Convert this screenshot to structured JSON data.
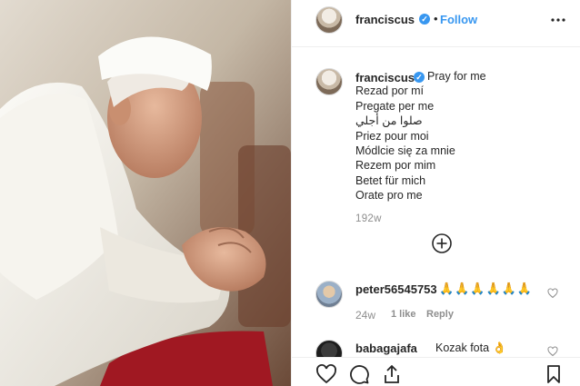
{
  "post": {
    "photo": "praying-man-photo"
  },
  "header": {
    "username": "franciscus",
    "verified_mark": "✓",
    "separator": "•",
    "follow_label": "Follow",
    "more_icon": "more-options-icon"
  },
  "caption": {
    "username": "franciscus",
    "verified_mark": "✓",
    "lines": [
      "Pray for me",
      "Rezad por mí",
      "Pregate per me",
      "صلوا من أجلي",
      "Priez pour moi",
      "Módlcie się za mnie",
      "Rezem por mim",
      "Betet für mich",
      "Orate pro me"
    ],
    "timestamp": "192w",
    "load_more_icon": "plus-circle-icon"
  },
  "comments": [
    {
      "username": "peter56545753",
      "text": "🙏🙏🙏🙏🙏🙏",
      "age": "24w",
      "likes": "1 like",
      "reply_label": "Reply"
    },
    {
      "username": "babagajafa",
      "text": "Kozak fota 👌"
    }
  ],
  "actions": {
    "like_icon": "heart-icon",
    "comment_icon": "comment-icon",
    "share_icon": "share-icon",
    "save_icon": "bookmark-icon"
  },
  "colors": {
    "accent": "#3897f0",
    "text": "#262626",
    "muted": "#8e8e8e",
    "border": "#efefef"
  }
}
